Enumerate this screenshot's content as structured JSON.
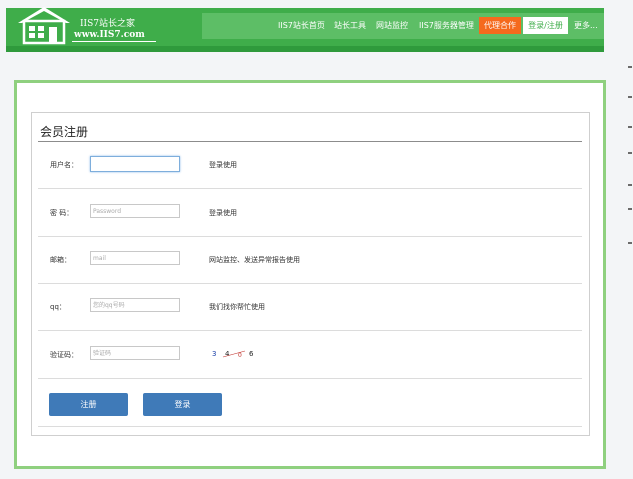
{
  "logo": {
    "title": "IIS7站长之家",
    "url": "www.IIS7.com"
  },
  "nav": {
    "items": [
      "IIS7站长首页",
      "站长工具",
      "网站监控",
      "IIS7服务器管理"
    ],
    "agent_label": "代理合作",
    "login_label": "登录/注册",
    "more_label": "更多..."
  },
  "form": {
    "title": "会员注册",
    "rows": [
      {
        "label": "用户名：",
        "value": "",
        "placeholder": "",
        "hint": "登录使用"
      },
      {
        "label": "密  码：",
        "value": "",
        "placeholder": "Password",
        "hint": "登录使用"
      },
      {
        "label": "邮箱：",
        "value": "",
        "placeholder": "mail",
        "hint": "网站监控、发送异常报告使用"
      },
      {
        "label": "qq：",
        "value": "",
        "placeholder": "您的qq号码",
        "hint": "我们找你帮忙使用"
      },
      {
        "label": "验证码：",
        "value": "",
        "placeholder": "验证码",
        "hint": ""
      }
    ],
    "captcha_chars": [
      "3",
      "4",
      "0",
      "6"
    ],
    "register_label": "注册",
    "login_label": "登录"
  },
  "colors": {
    "brand_green": "#3fad4a",
    "agent_orange": "#f56a1d",
    "button_blue": "#3f7ab8"
  }
}
